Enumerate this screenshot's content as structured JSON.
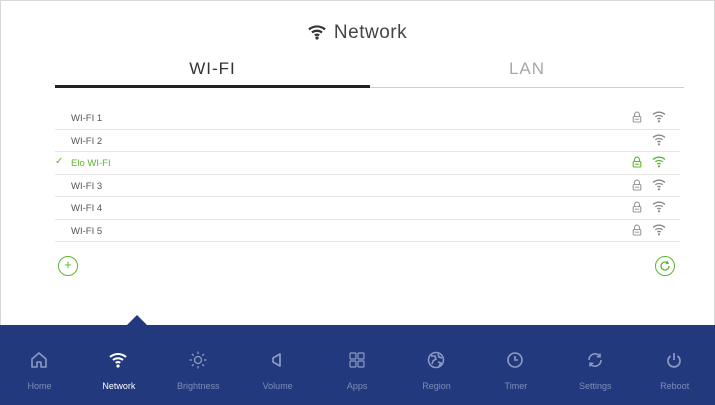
{
  "header": {
    "title": "Network",
    "icon": "wifi-icon"
  },
  "tabs": [
    {
      "label": "WI-FI",
      "active": true
    },
    {
      "label": "LAN",
      "active": false
    }
  ],
  "networks": [
    {
      "name": "WI-FI 1",
      "secured": true,
      "connected": false
    },
    {
      "name": "WI-FI 2",
      "secured": false,
      "connected": false
    },
    {
      "name": "Elo WI-FI",
      "secured": true,
      "connected": true
    },
    {
      "name": "WI-FI 3",
      "secured": true,
      "connected": false
    },
    {
      "name": "WI-FI 4",
      "secured": true,
      "connected": false
    },
    {
      "name": "WI-FI 5",
      "secured": true,
      "connected": false
    }
  ],
  "actions": {
    "add_icon": "plus-circle-icon",
    "add_symbol": "+",
    "refresh_icon": "refresh-icon"
  },
  "nav": [
    {
      "label": "Home",
      "icon": "home-icon",
      "active": false
    },
    {
      "label": "Network",
      "icon": "wifi-icon",
      "active": true
    },
    {
      "label": "Brightness",
      "icon": "sun-icon",
      "active": false
    },
    {
      "label": "Volume",
      "icon": "speaker-icon",
      "active": false
    },
    {
      "label": "Apps",
      "icon": "apps-grid-icon",
      "active": false
    },
    {
      "label": "Region",
      "icon": "globe-icon",
      "active": false
    },
    {
      "label": "Timer",
      "icon": "clock-icon",
      "active": false
    },
    {
      "label": "Settings",
      "icon": "settings-cycle-icon",
      "active": false
    },
    {
      "label": "Reboot",
      "icon": "power-icon",
      "active": false
    }
  ],
  "colors": {
    "accent": "#5cb531",
    "nav_bg": "#22397e",
    "nav_inactive": "#7f8db5",
    "text": "#444444"
  }
}
